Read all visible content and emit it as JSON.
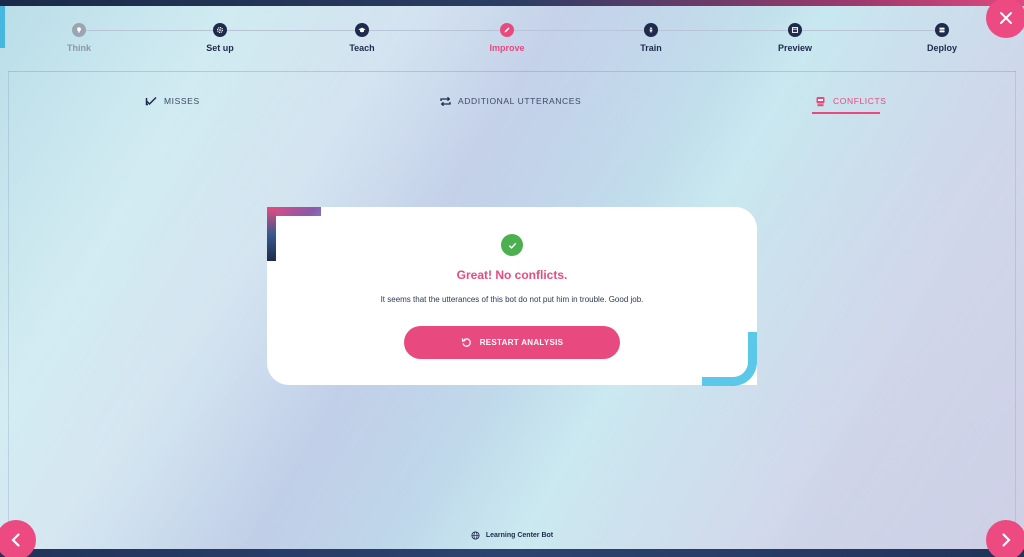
{
  "stepper": {
    "steps": [
      {
        "label": "Think",
        "icon": "lightbulb-icon",
        "state": "done"
      },
      {
        "label": "Set up",
        "icon": "gear-icon",
        "state": "default"
      },
      {
        "label": "Teach",
        "icon": "graduation-cap-icon",
        "state": "default"
      },
      {
        "label": "Improve",
        "icon": "pencil-icon",
        "state": "active"
      },
      {
        "label": "Train",
        "icon": "rocket-icon",
        "state": "default"
      },
      {
        "label": "Preview",
        "icon": "preview-window-icon",
        "state": "default"
      },
      {
        "label": "Deploy",
        "icon": "server-icon",
        "state": "default"
      }
    ]
  },
  "tabs": {
    "misses": {
      "label": "MISSES",
      "icon": "check-miss-icon"
    },
    "additional": {
      "label": "ADDITIONAL UTTERANCES",
      "icon": "repeat-icon"
    },
    "conflicts": {
      "label": "CONFLICTS",
      "icon": "robot-icon",
      "active": true
    }
  },
  "card": {
    "title": "Great! No conflicts.",
    "message": "It seems that the utterances of this bot do not put him in trouble. Good job.",
    "button_label": "RESTART ANALYSIS",
    "status_icon": "success-check-icon"
  },
  "footer": {
    "bot_name": "Learning Center Bot",
    "icon": "globe-icon"
  },
  "colors": {
    "accent": "#e84a7f",
    "navy": "#1f2b4d",
    "success": "#4caf50",
    "deco_blue": "#5bc8ea"
  }
}
